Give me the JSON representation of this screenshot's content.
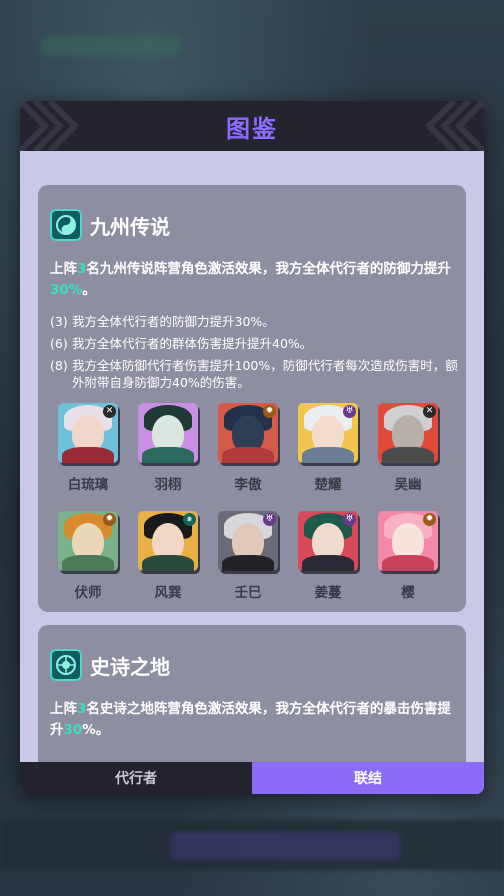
{
  "window": {
    "title": "图鉴"
  },
  "tabs": [
    {
      "label": "代行者",
      "active": false
    },
    {
      "label": "联结",
      "active": true
    }
  ],
  "factions": [
    {
      "name": "九州传说",
      "desc": {
        "p1": "上阵",
        "count": "3",
        "p2": "名九州传说阵营角色激活效果，我方全体代行者的防御力提升",
        "pct": "30%",
        "p3": "。"
      },
      "effects": [
        {
          "level": "(3)",
          "text": "我方全体代行者的防御力提升30%。"
        },
        {
          "level": "(6)",
          "text": "我方全体代行者的群体伤害提升提升40%。"
        },
        {
          "level": "(8)",
          "text": "我方全体防御代行者伤害提升100%，防御代行者每次造成伤害时，额外附带自身防御力40%的伤害。"
        }
      ],
      "heroes": [
        {
          "name": "白琉璃",
          "badge": "✕"
        },
        {
          "name": "羽栩",
          "badge": ""
        },
        {
          "name": "李傲",
          "badge": "✹"
        },
        {
          "name": "楚耀",
          "badge": "♅"
        },
        {
          "name": "吴幽",
          "badge": "✕"
        },
        {
          "name": "伏师",
          "badge": "✹"
        },
        {
          "name": "风巽",
          "badge": "๑"
        },
        {
          "name": "壬巳",
          "badge": "♅"
        },
        {
          "name": "姜蔓",
          "badge": "♅"
        },
        {
          "name": "樱",
          "badge": "✹"
        }
      ]
    },
    {
      "name": "史诗之地",
      "desc": {
        "p1": "上阵",
        "count": "3",
        "p2": "名史诗之地阵营角色激活效果，我方全体代行者的暴击伤害提升",
        "pct": "30",
        "p3": "%。"
      }
    }
  ],
  "colors": {
    "accent": "#8b6cf6",
    "highlight": "#39e0c0",
    "panel": "#c9c8e6",
    "card": "#8e8ea2"
  }
}
